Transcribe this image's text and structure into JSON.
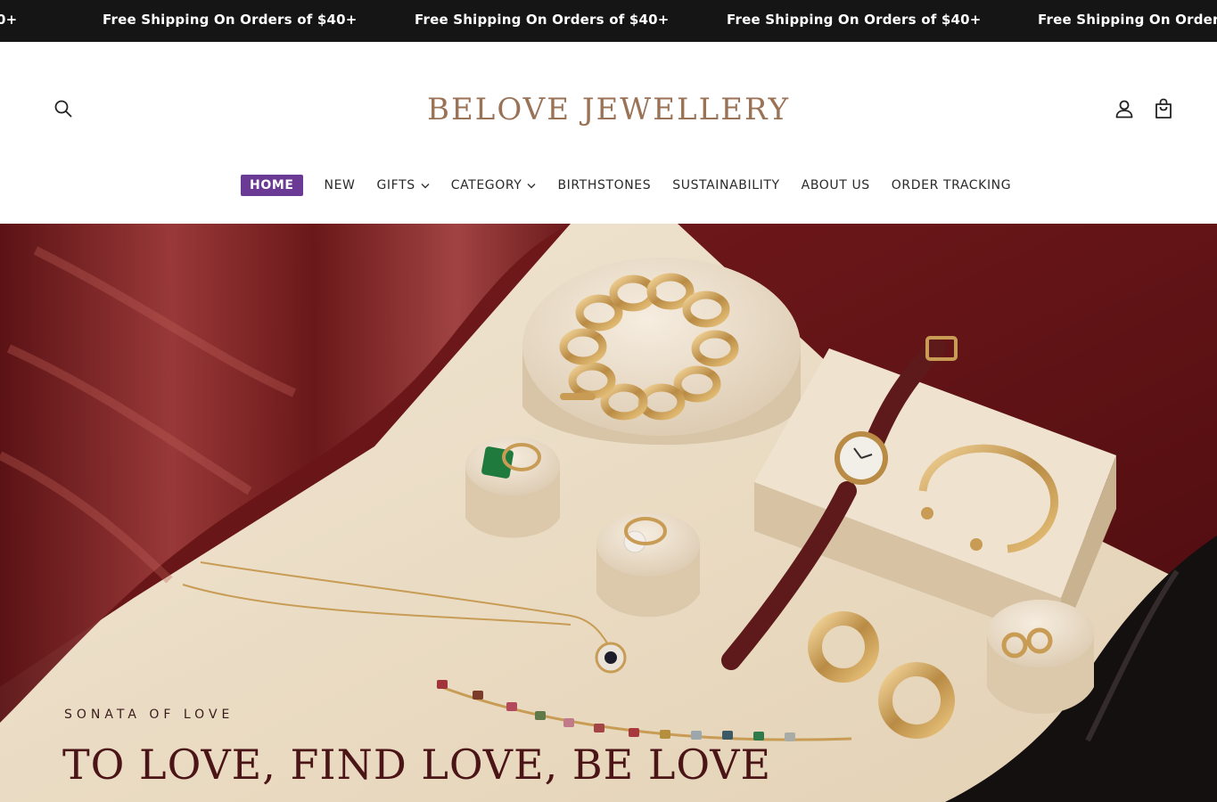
{
  "announcement": {
    "text": "Free Shipping On Orders of $40+",
    "leading_fragment": "0+",
    "trailing_fragment": "Free Shipping On Orders of"
  },
  "header": {
    "logo": "BELOVE JEWELLERY",
    "icons": {
      "search": "search-icon",
      "account": "account-icon",
      "cart": "cart-icon"
    }
  },
  "nav": {
    "items": [
      {
        "label": "HOME",
        "active": true
      },
      {
        "label": "NEW"
      },
      {
        "label": "GIFTS",
        "dropdown": true
      },
      {
        "label": "CATEGORY",
        "dropdown": true
      },
      {
        "label": "BIRTHSTONES"
      },
      {
        "label": "SUSTAINABILITY"
      },
      {
        "label": "ABOUT US"
      },
      {
        "label": "ORDER TRACKING"
      }
    ]
  },
  "hero": {
    "eyebrow": "SONATA OF LOVE",
    "headline": "TO LOVE, FIND LOVE, BE LOVE"
  },
  "colors": {
    "announcement_bg": "#151515",
    "logo": "#9a7256",
    "active_nav": "#6b3a94",
    "hero_red": "#5a0f12",
    "hero_cream": "#eadcc6"
  }
}
